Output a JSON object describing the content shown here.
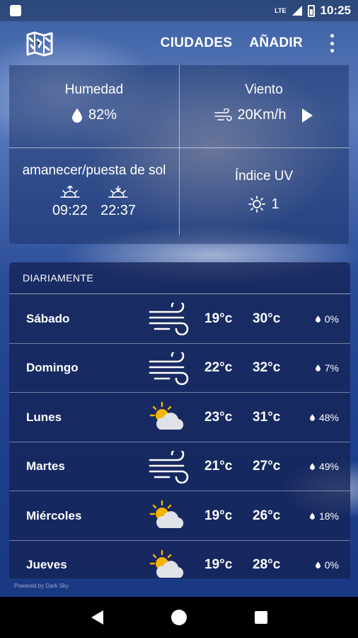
{
  "status_bar": {
    "network": "LTE",
    "time": "10:25"
  },
  "app_bar": {
    "cities_label": "CIUDADES",
    "add_label": "AÑADIR",
    "logo_icon": "map-icon",
    "menu_icon": "more-vert-icon"
  },
  "conditions": {
    "humidity": {
      "title": "Humedad",
      "value": "82%",
      "icon": "water-drop-icon"
    },
    "wind": {
      "title": "Viento",
      "value": "20Km/h",
      "icon": "wind-icon",
      "direction_icon": "wind-direction-arrow-icon"
    },
    "sun": {
      "title": "amanecer/puesta de sol",
      "sunrise": "09:22",
      "sunset": "22:37",
      "sunrise_icon": "sunrise-icon",
      "sunset_icon": "sunset-icon"
    },
    "uv": {
      "title": "Índice UV",
      "value": "1",
      "icon": "sun-icon"
    }
  },
  "daily": {
    "header": "DIARIAMENTE",
    "days": [
      {
        "day": "Sábado",
        "icon": "wind-icon",
        "min": "19°c",
        "max": "30°c",
        "rain": "0%"
      },
      {
        "day": "Domingo",
        "icon": "wind-icon",
        "min": "22°c",
        "max": "32°c",
        "rain": "7%"
      },
      {
        "day": "Lunes",
        "icon": "partly-cloudy-icon",
        "min": "23°c",
        "max": "31°c",
        "rain": "48%"
      },
      {
        "day": "Martes",
        "icon": "wind-icon",
        "min": "21°c",
        "max": "27°c",
        "rain": "49%"
      },
      {
        "day": "Miércoles",
        "icon": "partly-cloudy-icon",
        "min": "19°c",
        "max": "26°c",
        "rain": "18%"
      },
      {
        "day": "Jueves",
        "icon": "partly-cloudy-icon",
        "min": "19°c",
        "max": "28°c",
        "rain": "0%"
      }
    ]
  },
  "footer": {
    "powered_by": "Powered by Dark Sky"
  },
  "colors": {
    "panel": "#1d3f8c",
    "text": "#ffffff"
  }
}
